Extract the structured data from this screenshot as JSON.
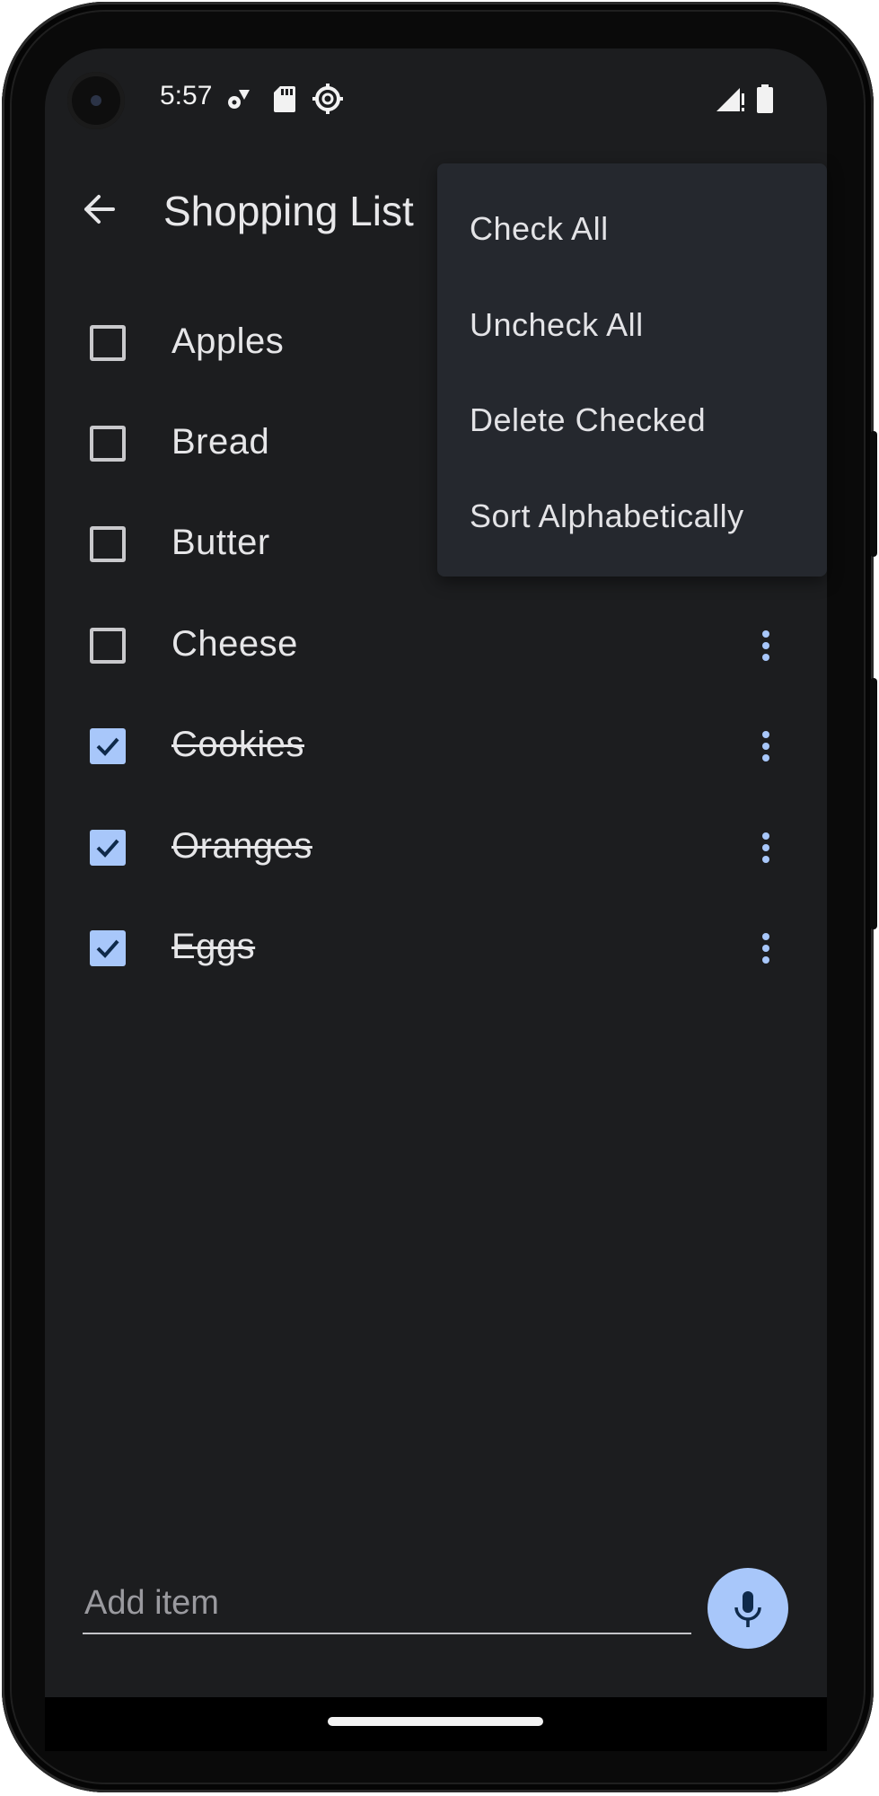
{
  "status_bar": {
    "time": "5:57",
    "left_icons": [
      "settings-sync-icon",
      "sd-card-icon",
      "gear-badge-icon"
    ],
    "right_icons": [
      "signal-alert-icon",
      "battery-icon"
    ]
  },
  "app_bar": {
    "back_icon": "arrow-back-icon",
    "title": "Shopping List"
  },
  "items": [
    {
      "label": "Apples",
      "checked": false
    },
    {
      "label": "Bread",
      "checked": false
    },
    {
      "label": "Butter",
      "checked": false
    },
    {
      "label": "Cheese",
      "checked": false
    },
    {
      "label": "Cookies",
      "checked": true
    },
    {
      "label": "Oranges",
      "checked": true
    },
    {
      "label": "Eggs",
      "checked": true
    }
  ],
  "menu": {
    "items": [
      "Check All",
      "Uncheck All",
      "Delete Checked",
      "Sort Alphabetically"
    ]
  },
  "add_item": {
    "placeholder": "Add item"
  },
  "mic_button": {
    "icon": "microphone-icon"
  },
  "colors": {
    "background": "#1c1d1f",
    "accent": "#a8c7fa",
    "menu_background": "#25282e",
    "text": "#e6e6e8"
  }
}
